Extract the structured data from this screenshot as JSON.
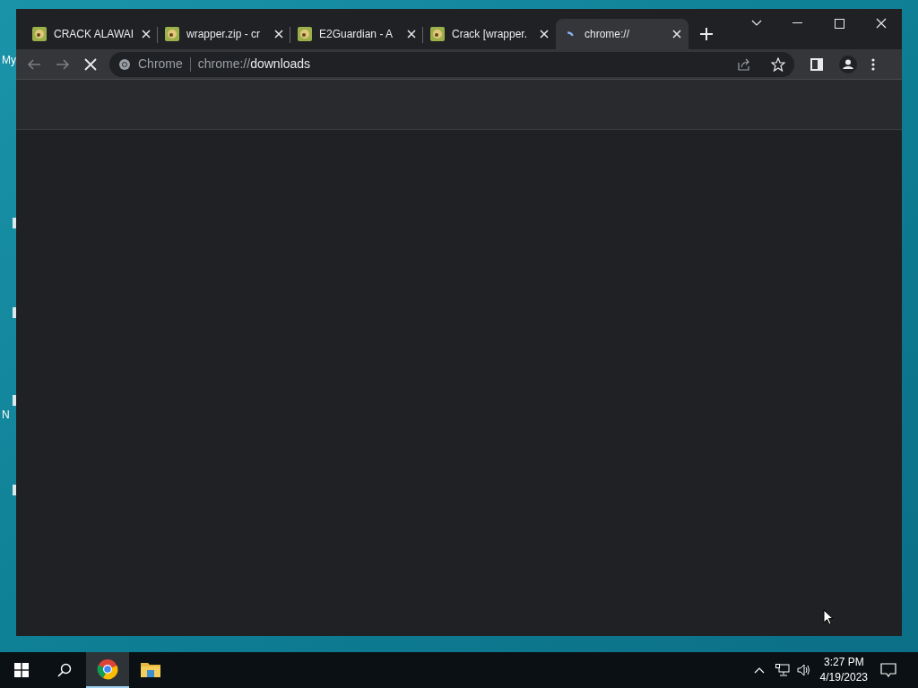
{
  "desktop": {
    "labels": [
      "My",
      "N"
    ]
  },
  "browser": {
    "tabs": [
      {
        "title": "CRACK ALAWAI",
        "loading": false,
        "selected": false
      },
      {
        "title": "wrapper.zip - cr",
        "loading": false,
        "selected": false
      },
      {
        "title": "E2Guardian - A",
        "loading": false,
        "selected": false
      },
      {
        "title": "Crack [wrapper.",
        "loading": false,
        "selected": false
      },
      {
        "title": "chrome://",
        "loading": true,
        "selected": true
      }
    ],
    "address": {
      "site_label": "Chrome",
      "url_prefix": "chrome://",
      "url_path": "downloads"
    },
    "loading": true
  },
  "taskbar": {
    "apps": [
      {
        "kind": "chrome",
        "selected": true
      },
      {
        "kind": "explorer",
        "selected": false
      }
    ],
    "time": "3:27 PM",
    "date": "4/19/2023"
  }
}
